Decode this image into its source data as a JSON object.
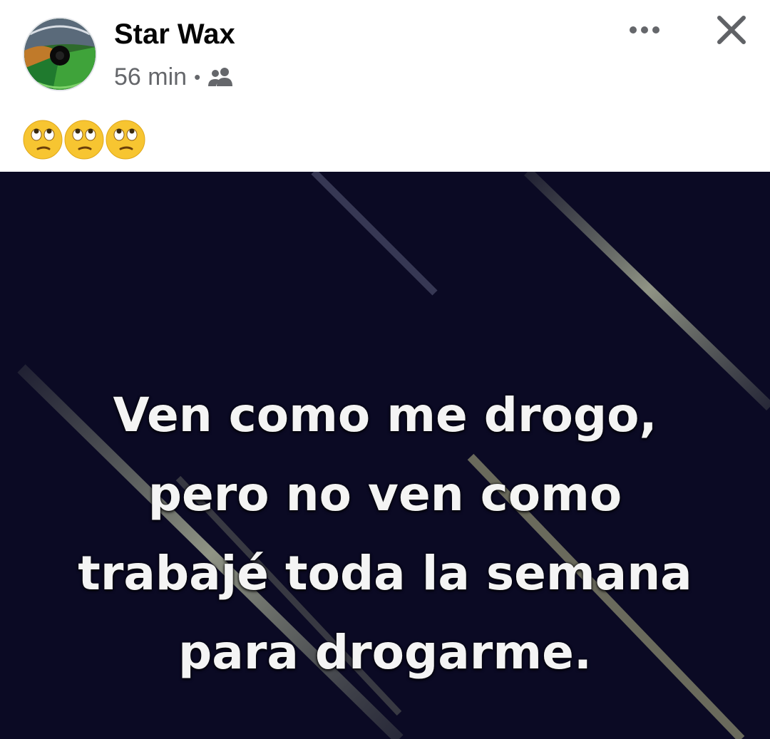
{
  "post": {
    "author": "Star Wax",
    "timestamp": "56 min",
    "separator": "•",
    "audience_icon": "friends-icon",
    "more_icon": "more-options-icon",
    "close_icon": "close-icon",
    "caption_emojis": [
      "face-with-rolling-eyes",
      "face-with-rolling-eyes",
      "face-with-rolling-eyes"
    ]
  },
  "photo": {
    "text_lines": [
      "Ven como me drogo,",
      "pero no ven como",
      "trabajé toda la semana",
      "para drogarme."
    ]
  },
  "colors": {
    "author_text": "#050505",
    "meta_text": "#65676b",
    "photo_background": "#0b0a24",
    "meme_text": "#f4f4f4"
  }
}
